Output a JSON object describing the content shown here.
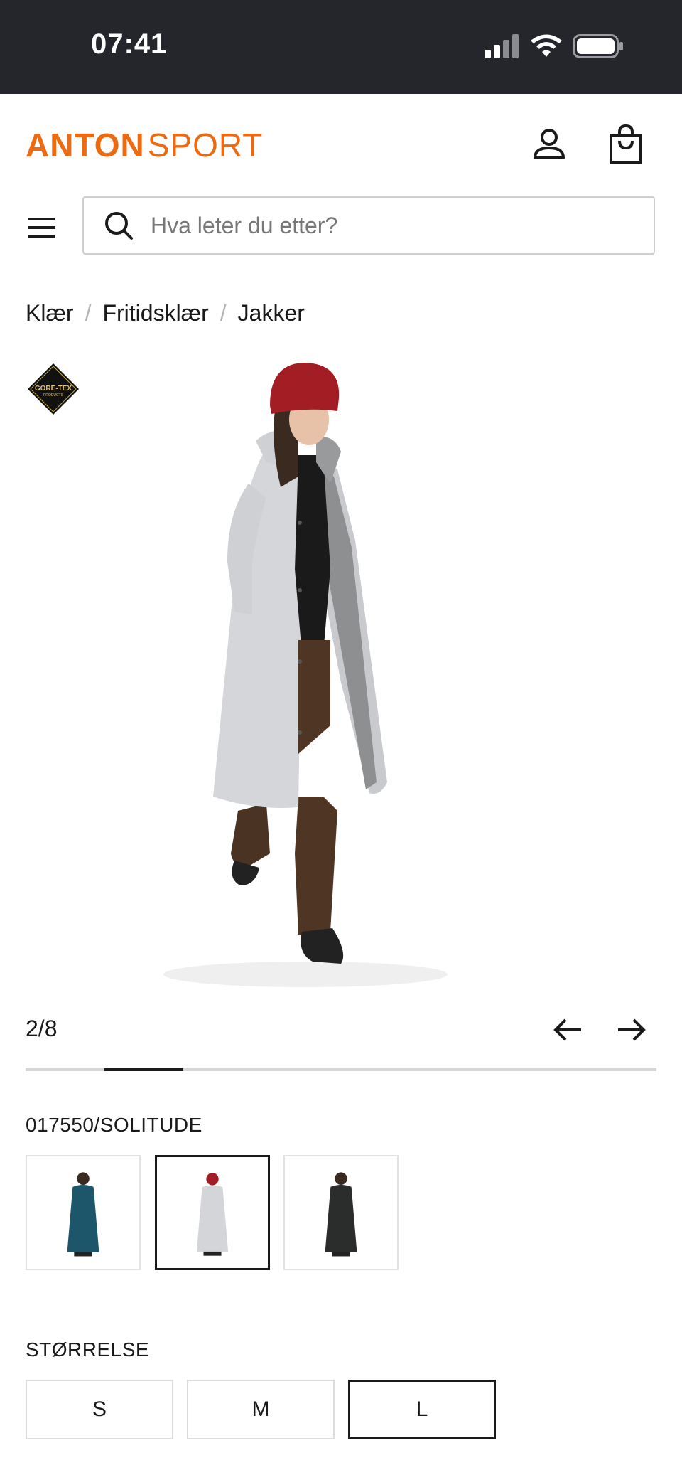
{
  "status_bar": {
    "time": "07:41"
  },
  "header": {
    "logo_bold": "ANTON",
    "logo_thin": "SPORT"
  },
  "search": {
    "placeholder": "Hva leter du etter?"
  },
  "breadcrumb": [
    "Klær",
    "Fritidsklær",
    "Jakker"
  ],
  "badge": {
    "brand": "GORE-TEX",
    "sub": "PRODUCTS"
  },
  "gallery": {
    "counter": "2/8",
    "current": 2,
    "total": 8
  },
  "variant": {
    "code_label": "017550/SOLITUDE",
    "swatches": [
      {
        "color": "#1d566a",
        "selected": false
      },
      {
        "color": "#d3d5d8",
        "selected": true
      },
      {
        "color": "#2b2c2c",
        "selected": false
      }
    ]
  },
  "size": {
    "label": "STØRRELSE",
    "options": [
      {
        "label": "S",
        "selected": false
      },
      {
        "label": "M",
        "selected": false
      },
      {
        "label": "L",
        "selected": true
      }
    ]
  },
  "colors": {
    "accent": "#ee6a10",
    "dark": "#24262b"
  }
}
